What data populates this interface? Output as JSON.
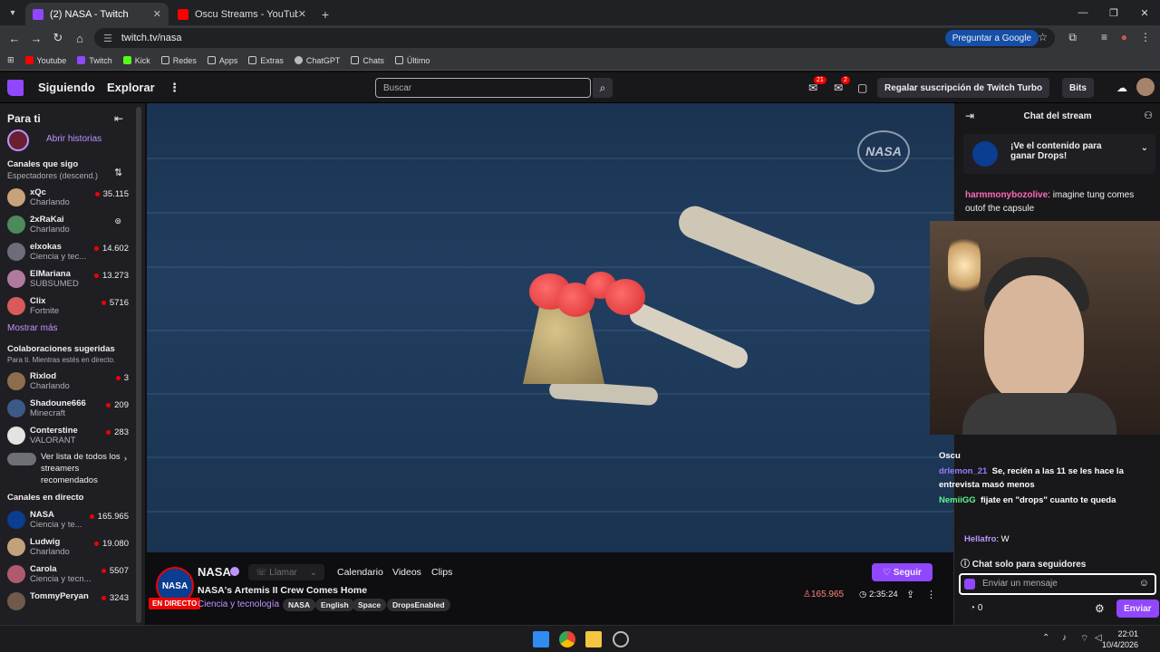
{
  "browser": {
    "tabs": [
      {
        "title": "(2) NASA - Twitch",
        "color": "#9147ff"
      },
      {
        "title": "Oscu Streams - YouTube",
        "color": "#ff0000"
      }
    ],
    "url": "twitch.tv/nasa",
    "google_button": "Preguntar a Google",
    "bookmarks": [
      "Youtube",
      "Twitch",
      "Kick",
      "Redes",
      "Apps",
      "Extras",
      "ChatGPT",
      "Chats",
      "Último"
    ]
  },
  "twitch": {
    "nav": {
      "following": "Siguiendo",
      "browse": "Explorar",
      "search_placeholder": "Buscar",
      "notif_badge": "21",
      "inbox_badge": "2",
      "turbo": "Regalar suscripción de Twitch Turbo",
      "bits": "Bits"
    },
    "sidebar": {
      "title": "Para ti",
      "stories": "Abrir historias",
      "followed_title": "Canales que sigo",
      "followed_sub": "Espectadores (descend.)",
      "followed": [
        {
          "name": "xQc",
          "cat": "Charlando",
          "viewers": "35.115",
          "color": "#c9a27b"
        },
        {
          "name": "2xRaKai",
          "cat": "Charlando",
          "viewers": "",
          "color": "#4b8a5a"
        },
        {
          "name": "elxokas",
          "cat": "Ciencia y tec...",
          "viewers": "14.602",
          "color": "#6d6d7a"
        },
        {
          "name": "ElMariana",
          "cat": "SUBSUMED",
          "viewers": "13.273",
          "color": "#b07a9e"
        },
        {
          "name": "Clix",
          "cat": "Fortnite",
          "viewers": "5716",
          "color": "#d85a5a"
        }
      ],
      "show_more": "Mostrar más",
      "collab_title": "Colaboraciones sugeridas",
      "collab_sub": "Para ti. Mientras estés en directo.",
      "collabs": [
        {
          "name": "Rixlod",
          "cat": "Charlando",
          "viewers": "3",
          "color": "#8d6e4c"
        },
        {
          "name": "Shadoune666",
          "cat": "Minecraft",
          "viewers": "209",
          "color": "#3c5a88"
        },
        {
          "name": "Conterstine",
          "cat": "VALORANT",
          "viewers": "283",
          "color": "#e3e3e3"
        }
      ],
      "see_all": "Ver lista de todos los streamers recomendados",
      "live_title": "Canales en directo",
      "live": [
        {
          "name": "NASA",
          "cat": "Ciencia y te...",
          "viewers": "165.965",
          "color": "#0b3d91"
        },
        {
          "name": "Ludwig",
          "cat": "Charlando",
          "viewers": "19.080",
          "color": "#c2a27a"
        },
        {
          "name": "Carola",
          "cat": "Ciencia y tecn...",
          "viewers": "5507",
          "color": "#b05a6e"
        },
        {
          "name": "TommyPeryan",
          "cat": "",
          "viewers": "3243",
          "color": "#6f5a4c"
        }
      ]
    },
    "video": {
      "watermark": "NASA"
    },
    "stream": {
      "logo": "NASA",
      "live": "EN DIRECTO",
      "channel": "NASA",
      "call": "Llamar",
      "tabs": [
        "Calendario",
        "Videos",
        "Clips"
      ],
      "follow": "Seguir",
      "title": "NASA's Artemis II Crew Comes Home",
      "category": "Ciencia y tecnología",
      "tags": [
        "NASA",
        "English",
        "Space",
        "DropsEnabled"
      ],
      "viewers": "165.965",
      "uptime": "2:35:24"
    },
    "chat": {
      "header": "Chat del stream",
      "drops": "¡Ve el contenido para ganar Drops!",
      "messages": [
        {
          "user": "harmmonybozolive",
          "text": ": imagine tung comes outof the capsule",
          "color": "#ff69b4"
        }
      ],
      "overlay": [
        {
          "user": "Oscu",
          "text": "",
          "color": "#ffffff"
        },
        {
          "user": "drlemon_21",
          "text": "Se, recién a las 11 se les hace la entrevista masó menos",
          "color": "#9a7bff"
        },
        {
          "user": "NemiiGG",
          "text": "fijate en \"drops\" cuanto te queda",
          "color": "#5af78e"
        },
        {
          "user": "Hellafro",
          "text": ": W",
          "color": "#bf94ff"
        }
      ],
      "followers_only": "Chat solo para seguidores",
      "input_placeholder": "Enviar un mensaje",
      "points": "0",
      "send": "Enviar"
    }
  },
  "taskbar": {
    "time": "22:01",
    "date": "10/4/2026"
  }
}
